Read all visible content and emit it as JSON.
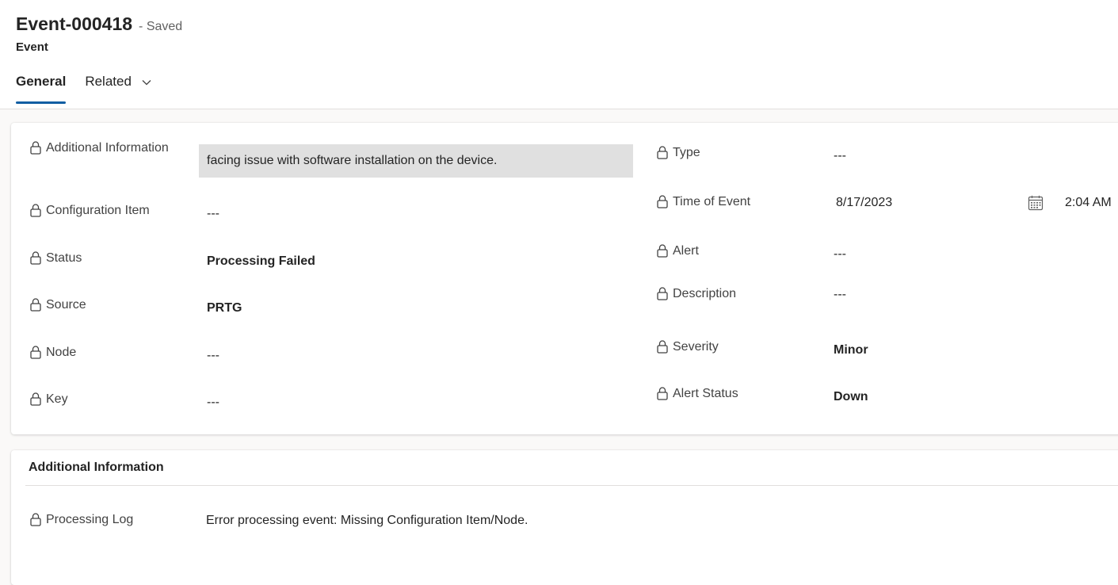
{
  "header": {
    "title": "Event-000418",
    "status": "- Saved",
    "entity": "Event"
  },
  "tabs": [
    {
      "label": "General",
      "active": true
    },
    {
      "label": "Related",
      "active": false
    }
  ],
  "fields_left": [
    {
      "label": "Additional Information",
      "value": "facing issue with software installation on the device."
    },
    {
      "label": "Configuration Item",
      "value": "---"
    },
    {
      "label": "Status",
      "value": "Processing Failed"
    },
    {
      "label": "Source",
      "value": "PRTG"
    },
    {
      "label": "Node",
      "value": "---"
    },
    {
      "label": "Key",
      "value": "---"
    }
  ],
  "fields_right": [
    {
      "label": "Type",
      "value": "---"
    },
    {
      "label": "Time of Event",
      "date": "8/17/2023",
      "time": "2:04 AM"
    },
    {
      "label": "Alert",
      "value": "---"
    },
    {
      "label": "Description",
      "value": "---"
    },
    {
      "label": "Severity",
      "value": "Minor"
    },
    {
      "label": "Alert Status",
      "value": "Down"
    }
  ],
  "section2": {
    "title": "Additional Information",
    "fields": [
      {
        "label": "Processing Log",
        "value": "Error processing event: Missing Configuration Item/Node."
      }
    ]
  },
  "colors": {
    "accent": "#115ea3",
    "readonly_box": "#e0e0e0",
    "background": "#faf9f8"
  },
  "icons": [
    "lock-icon",
    "calendar-icon",
    "chevron-down-icon"
  ]
}
